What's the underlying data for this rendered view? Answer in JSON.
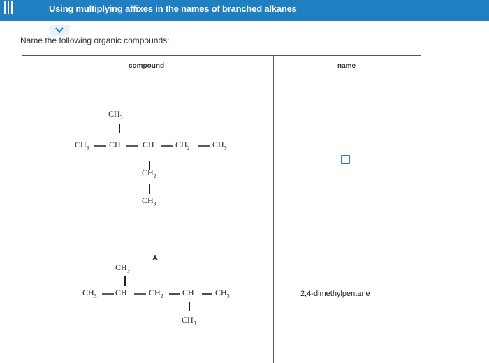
{
  "header": {
    "title": "Using multiplying affixes in the names of branched alkanes",
    "menu_icon": "hamburger-menu-icon",
    "bar_color": "#1f7fc1"
  },
  "collapse_icon": "chevron-down-icon",
  "instruction": "Name the following organic compounds:",
  "table": {
    "headers": {
      "compound": "compound",
      "name": "name"
    },
    "rows": [
      {
        "formula": {
          "top_ch3": "CH",
          "top_ch3_sub": "3",
          "main_chain": [
            "CH",
            "CH",
            "CH",
            "CH",
            "CH"
          ],
          "main_chain_subs": [
            "3",
            "",
            "",
            "2",
            "3"
          ],
          "branch_ch2": "CH",
          "branch_ch2_sub": "2",
          "branch_ch3": "CH",
          "branch_ch3_sub": "3"
        },
        "name_value": ""
      },
      {
        "formula": {
          "top_ch3": "CH",
          "top_ch3_sub": "3",
          "main_chain": [
            "CH",
            "CH",
            "CH",
            "CH",
            "CH"
          ],
          "main_chain_subs": [
            "3",
            "",
            "2",
            "",
            "3"
          ],
          "bottom_ch3": "CH",
          "bottom_ch3_sub": "3"
        },
        "name_value": "2,4-dimethylpentane"
      }
    ]
  }
}
